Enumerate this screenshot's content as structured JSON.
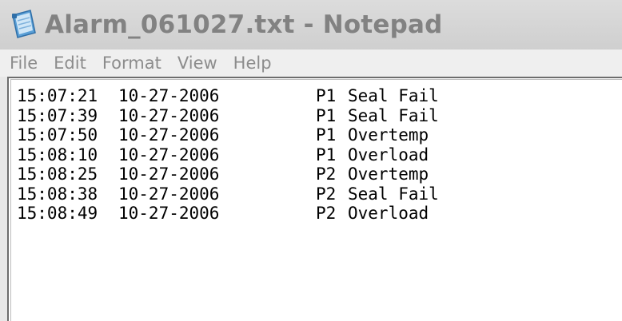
{
  "window": {
    "title": "Alarm_061027.txt - Notepad",
    "icon": "notepad-icon",
    "colors": {
      "titlebar_bg": "#d4d4d4",
      "title_text": "#828282",
      "menu_text": "#8c8c8c",
      "editor_bg": "#ffffff",
      "text": "#000000"
    }
  },
  "menu": {
    "items": [
      {
        "label": "File"
      },
      {
        "label": "Edit"
      },
      {
        "label": "Format"
      },
      {
        "label": "View"
      },
      {
        "label": "Help"
      }
    ]
  },
  "editor": {
    "lines": [
      {
        "time": "15:07:21",
        "date": "10-27-2006",
        "pump": "P1",
        "message": "Seal Fail"
      },
      {
        "time": "15:07:39",
        "date": "10-27-2006",
        "pump": "P1",
        "message": "Seal Fail"
      },
      {
        "time": "15:07:50",
        "date": "10-27-2006",
        "pump": "P1",
        "message": "Overtemp"
      },
      {
        "time": "15:08:10",
        "date": "10-27-2006",
        "pump": "P1",
        "message": "Overload"
      },
      {
        "time": "15:08:25",
        "date": "10-27-2006",
        "pump": "P2",
        "message": "Overtemp"
      },
      {
        "time": "15:08:38",
        "date": "10-27-2006",
        "pump": "P2",
        "message": "Seal Fail"
      },
      {
        "time": "15:08:49",
        "date": "10-27-2006",
        "pump": "P2",
        "message": "Overload"
      }
    ]
  }
}
